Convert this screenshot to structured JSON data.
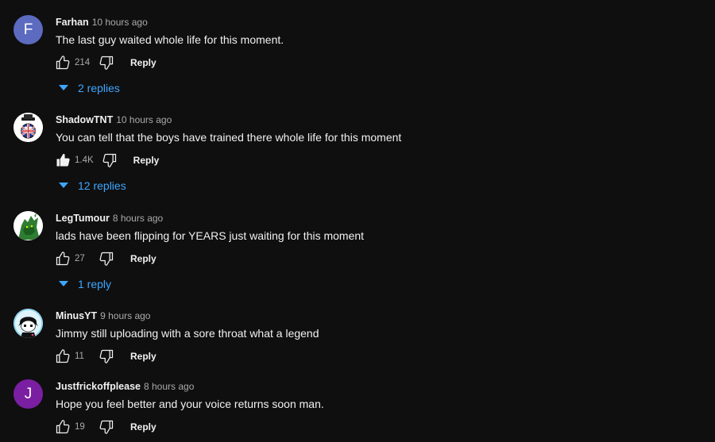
{
  "comments": [
    {
      "author": "Farhan",
      "time": "10 hours ago",
      "text": "The last guy waited whole life for this moment.",
      "likes": "214",
      "liked": false,
      "reply_label": "Reply",
      "replies_label": "2 replies",
      "avatar": {
        "type": "letter",
        "letter": "F",
        "color": "#5c6bc0"
      }
    },
    {
      "author": "ShadowTNT",
      "time": "10 hours ago",
      "text": "You can tell that the boys have trained there whole life for this moment",
      "likes": "1.4K",
      "liked": true,
      "reply_label": "Reply",
      "replies_label": "12 replies",
      "avatar": {
        "type": "image",
        "icon": "top-hat-union-jack-ball-icon"
      }
    },
    {
      "author": "LegTumour",
      "time": "8 hours ago",
      "text": "lads have been flipping for YEARS just waiting for this moment",
      "likes": "27",
      "liked": false,
      "reply_label": "Reply",
      "replies_label": "1 reply",
      "avatar": {
        "type": "image",
        "icon": "green-creature-icon"
      }
    },
    {
      "author": "MinusYT",
      "time": "9 hours ago",
      "text": "Jimmy still uploading with a sore throat what a legend",
      "likes": "11",
      "liked": false,
      "reply_label": "Reply",
      "avatar": {
        "type": "image",
        "icon": "cartoon-character-icon"
      }
    },
    {
      "author": "Justfrickoffplease",
      "time": "8 hours ago",
      "text": "Hope you feel better and your voice returns soon man.",
      "likes": "19",
      "liked": false,
      "reply_label": "Reply",
      "avatar": {
        "type": "letter",
        "letter": "J",
        "color": "#7b1fa2"
      }
    }
  ],
  "colors": {
    "background": "#0f0f0f",
    "text": "#f1f1f1",
    "secondary_text": "#aaaaaa",
    "link": "#3ea6ff"
  }
}
